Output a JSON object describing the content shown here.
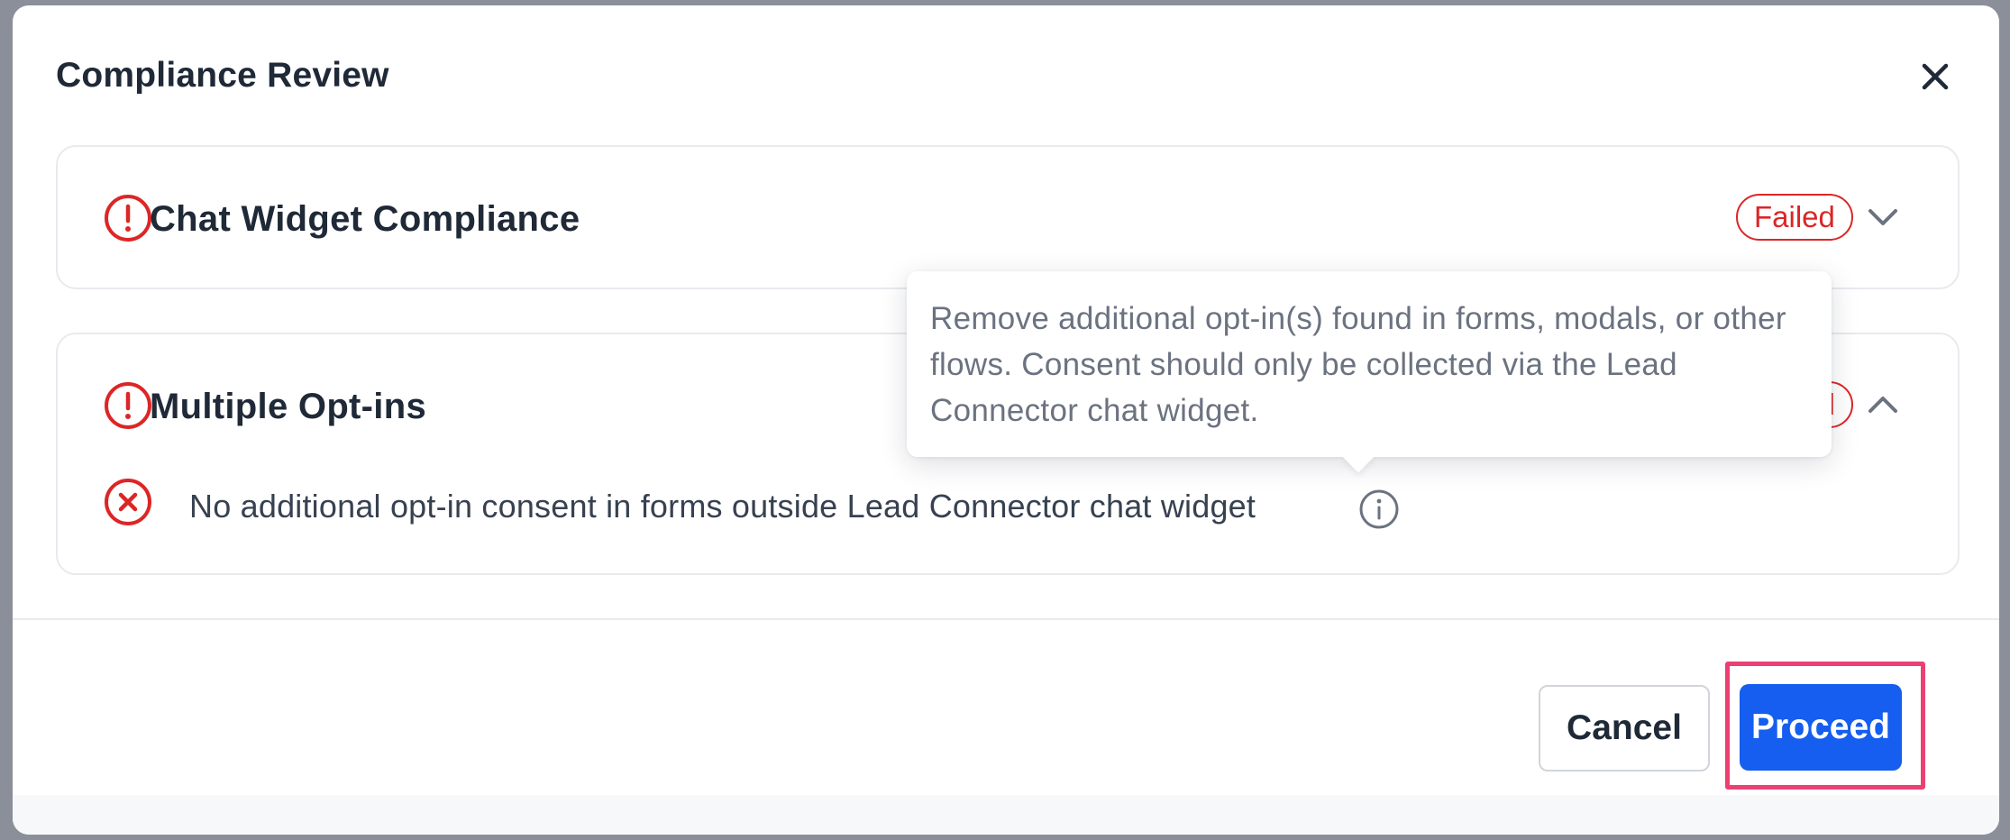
{
  "modal": {
    "title": "Compliance Review"
  },
  "icons": {
    "close": "close-icon",
    "alert": "alert-circle-icon",
    "error": "x-circle-icon",
    "info": "info-icon",
    "chevron_down": "chevron-down-icon",
    "chevron_up": "chevron-up-icon"
  },
  "checks": [
    {
      "title": "Chat Widget Compliance",
      "status": "Failed",
      "expanded": false
    },
    {
      "title": "Multiple Opt-ins",
      "status": "Failed",
      "expanded": true,
      "criteria": [
        {
          "text": "No additional opt-in consent in forms outside Lead Connector chat widget",
          "passed": false
        }
      ]
    }
  ],
  "tooltip": {
    "text": "Remove additional opt-in(s) found in forms, modals, or other flows. Consent should only be collected via the Lead Connector chat widget."
  },
  "footer": {
    "cancel_label": "Cancel",
    "proceed_label": "Proceed"
  },
  "colors": {
    "danger": "#dc2626",
    "primary": "#155eef",
    "highlight": "#ec3f72",
    "text": "#1f2937"
  }
}
